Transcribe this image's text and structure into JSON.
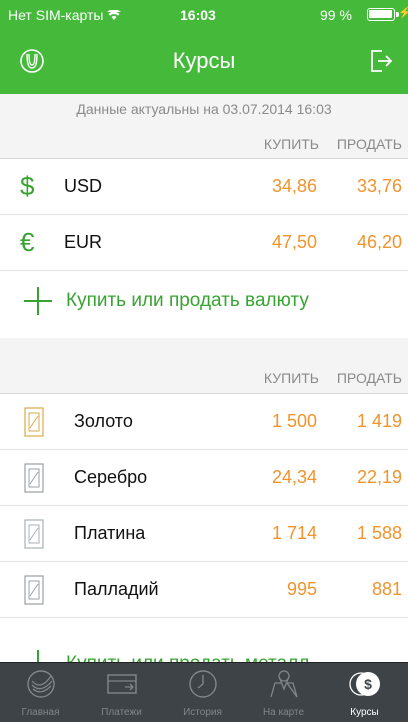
{
  "status": {
    "carrier": "Нет SIM-карты",
    "time": "16:03",
    "battery": "99 %"
  },
  "nav": {
    "title": "Курсы"
  },
  "updated": "Данные актуальны на 03.07.2014 16:03",
  "columns": {
    "buy": "КУПИТЬ",
    "sell": "ПРОДАТЬ"
  },
  "currencies": [
    {
      "symbol": "$",
      "code": "USD",
      "buy": "34,86",
      "sell": "33,76"
    },
    {
      "symbol": "€",
      "code": "EUR",
      "buy": "47,50",
      "sell": "46,20"
    }
  ],
  "currency_action": "Купить или продать валюту",
  "metals": [
    {
      "name": "Золото",
      "buy": "1 500",
      "sell": "1 419",
      "icon": "gold-bar-icon"
    },
    {
      "name": "Серебро",
      "buy": "24,34",
      "sell": "22,19",
      "icon": "silver-bar-icon"
    },
    {
      "name": "Платина",
      "buy": "1 714",
      "sell": "1 588",
      "icon": "platinum-bar-icon"
    },
    {
      "name": "Палладий",
      "buy": "995",
      "sell": "881",
      "icon": "palladium-bar-icon"
    }
  ],
  "metal_action": "Купить или продать металл",
  "tabs": [
    {
      "label": "Главная",
      "icon": "sberbank-logo-icon"
    },
    {
      "label": "Платежи",
      "icon": "payment-card-icon"
    },
    {
      "label": "История",
      "icon": "clock-icon"
    },
    {
      "label": "На карте",
      "icon": "map-pin-icon"
    },
    {
      "label": "Курсы",
      "icon": "dollar-coins-icon"
    }
  ],
  "colors": {
    "brand": "#45b93a",
    "accent_green": "#37a431",
    "value_orange": "#f2932c",
    "tabbar": "#3d4347"
  }
}
